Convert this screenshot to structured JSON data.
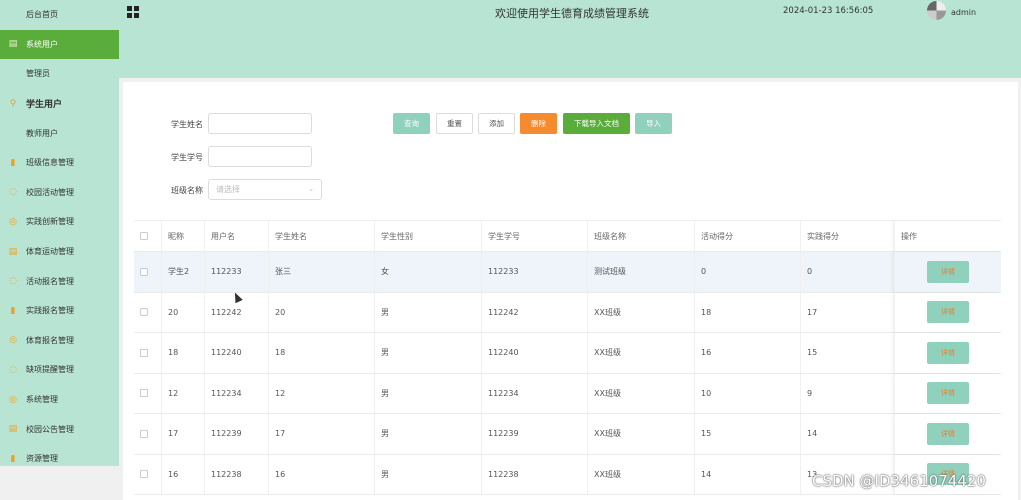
{
  "sidebar": {
    "items": [
      {
        "label": "后台首页",
        "icon": "none",
        "active": false,
        "bold": false
      },
      {
        "label": "系统用户",
        "icon": "doc-icon",
        "active": true,
        "bold": false
      },
      {
        "label": "管理员",
        "icon": "none",
        "active": false,
        "bold": false
      },
      {
        "label": "学生用户",
        "icon": "location-icon",
        "active": false,
        "bold": true
      },
      {
        "label": "教师用户",
        "icon": "none",
        "active": false,
        "bold": false
      },
      {
        "label": "班级信息管理",
        "icon": "bar-chart-icon",
        "active": false,
        "bold": false
      },
      {
        "label": "校园活动管理",
        "icon": "chat-icon",
        "active": false,
        "bold": false
      },
      {
        "label": "实践创新管理",
        "icon": "check-circle-icon",
        "active": false,
        "bold": false
      },
      {
        "label": "体育运动管理",
        "icon": "doc-icon",
        "active": false,
        "bold": false
      },
      {
        "label": "活动报名管理",
        "icon": "chat-icon",
        "active": false,
        "bold": false
      },
      {
        "label": "实践报名管理",
        "icon": "bar-chart-icon",
        "active": false,
        "bold": false
      },
      {
        "label": "体育报名管理",
        "icon": "check-circle-icon",
        "active": false,
        "bold": false
      },
      {
        "label": "缺项提醒管理",
        "icon": "chat-icon",
        "active": false,
        "bold": false
      },
      {
        "label": "系统管理",
        "icon": "check-circle-icon",
        "active": false,
        "bold": false
      },
      {
        "label": "校园公告管理",
        "icon": "doc-icon",
        "active": false,
        "bold": false
      },
      {
        "label": "资源管理",
        "icon": "bar-chart-icon",
        "active": false,
        "bold": false
      }
    ]
  },
  "header": {
    "title": "欢迎使用学生德育成绩管理系统",
    "datetime": "2024-01-23 16:56:05",
    "user": "admin"
  },
  "search": {
    "name_label": "学生姓名",
    "number_label": "学生学号",
    "class_label": "班级名称",
    "class_placeholder": "请选择"
  },
  "buttons": {
    "query": "查询",
    "reset": "重置",
    "add": "添加",
    "delete": "删除",
    "download": "下载导入文档",
    "import": "导入"
  },
  "table": {
    "headers": [
      "昵称",
      "用户名",
      "学生姓名",
      "学生性别",
      "学生学号",
      "班级名称",
      "活动得分",
      "实践得分",
      "操作"
    ],
    "rows": [
      [
        "学生2",
        "112233",
        "张三",
        "女",
        "112233",
        "测试班级",
        "0",
        "0"
      ],
      [
        "20",
        "112242",
        "20",
        "男",
        "112242",
        "XX班级",
        "18",
        "17"
      ],
      [
        "18",
        "112240",
        "18",
        "男",
        "112240",
        "XX班级",
        "16",
        "15"
      ],
      [
        "12",
        "112234",
        "12",
        "男",
        "112234",
        "XX班级",
        "10",
        "9"
      ],
      [
        "17",
        "112239",
        "17",
        "男",
        "112239",
        "XX班级",
        "15",
        "14"
      ],
      [
        "16",
        "112238",
        "16",
        "男",
        "112238",
        "XX班级",
        "14",
        "13"
      ]
    ],
    "detail_label": "详情"
  },
  "watermark": "CSDN @ID3461074420",
  "colors": {
    "mint": "#b8e4d3",
    "active_green": "#5aad3a",
    "teal_button": "#8fd1bd",
    "orange_button": "#f68a2e"
  }
}
